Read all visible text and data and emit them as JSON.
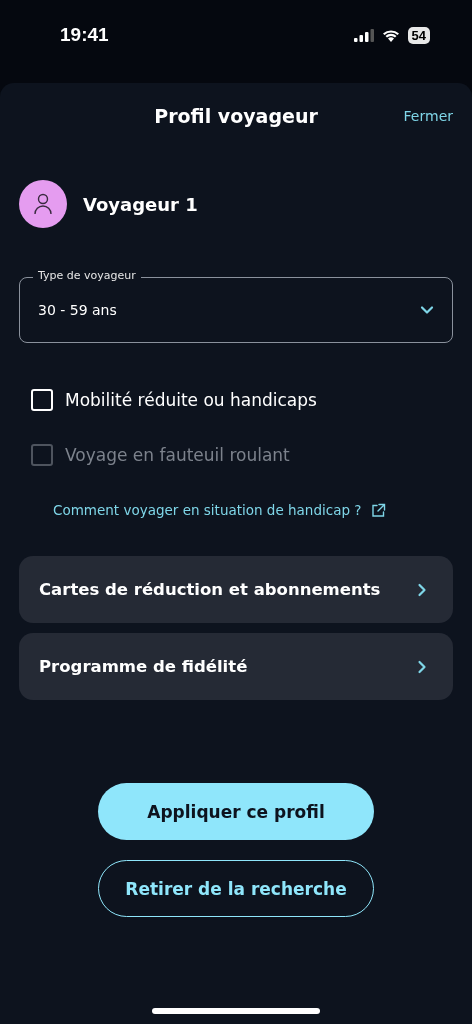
{
  "status_bar": {
    "time": "19:41",
    "battery": "54"
  },
  "header": {
    "title": "Profil voyageur",
    "close": "Fermer"
  },
  "traveler": {
    "name": "Voyageur 1"
  },
  "traveler_type": {
    "label": "Type de voyageur",
    "value": "30 - 59 ans"
  },
  "options": [
    {
      "label": "Mobilité réduite ou handicaps",
      "checked": false,
      "disabled": false
    },
    {
      "label": "Voyage en fauteuil roulant",
      "checked": false,
      "disabled": true
    }
  ],
  "help_link": "Comment voyager en situation de handicap ?",
  "menu": [
    {
      "label": "Cartes de réduction et abonnements"
    },
    {
      "label": "Programme de fidélité"
    }
  ],
  "buttons": [
    {
      "label": "Appliquer ce profil",
      "kind": "primary"
    },
    {
      "label": "Retirer de la recherche",
      "kind": "outline"
    }
  ]
}
